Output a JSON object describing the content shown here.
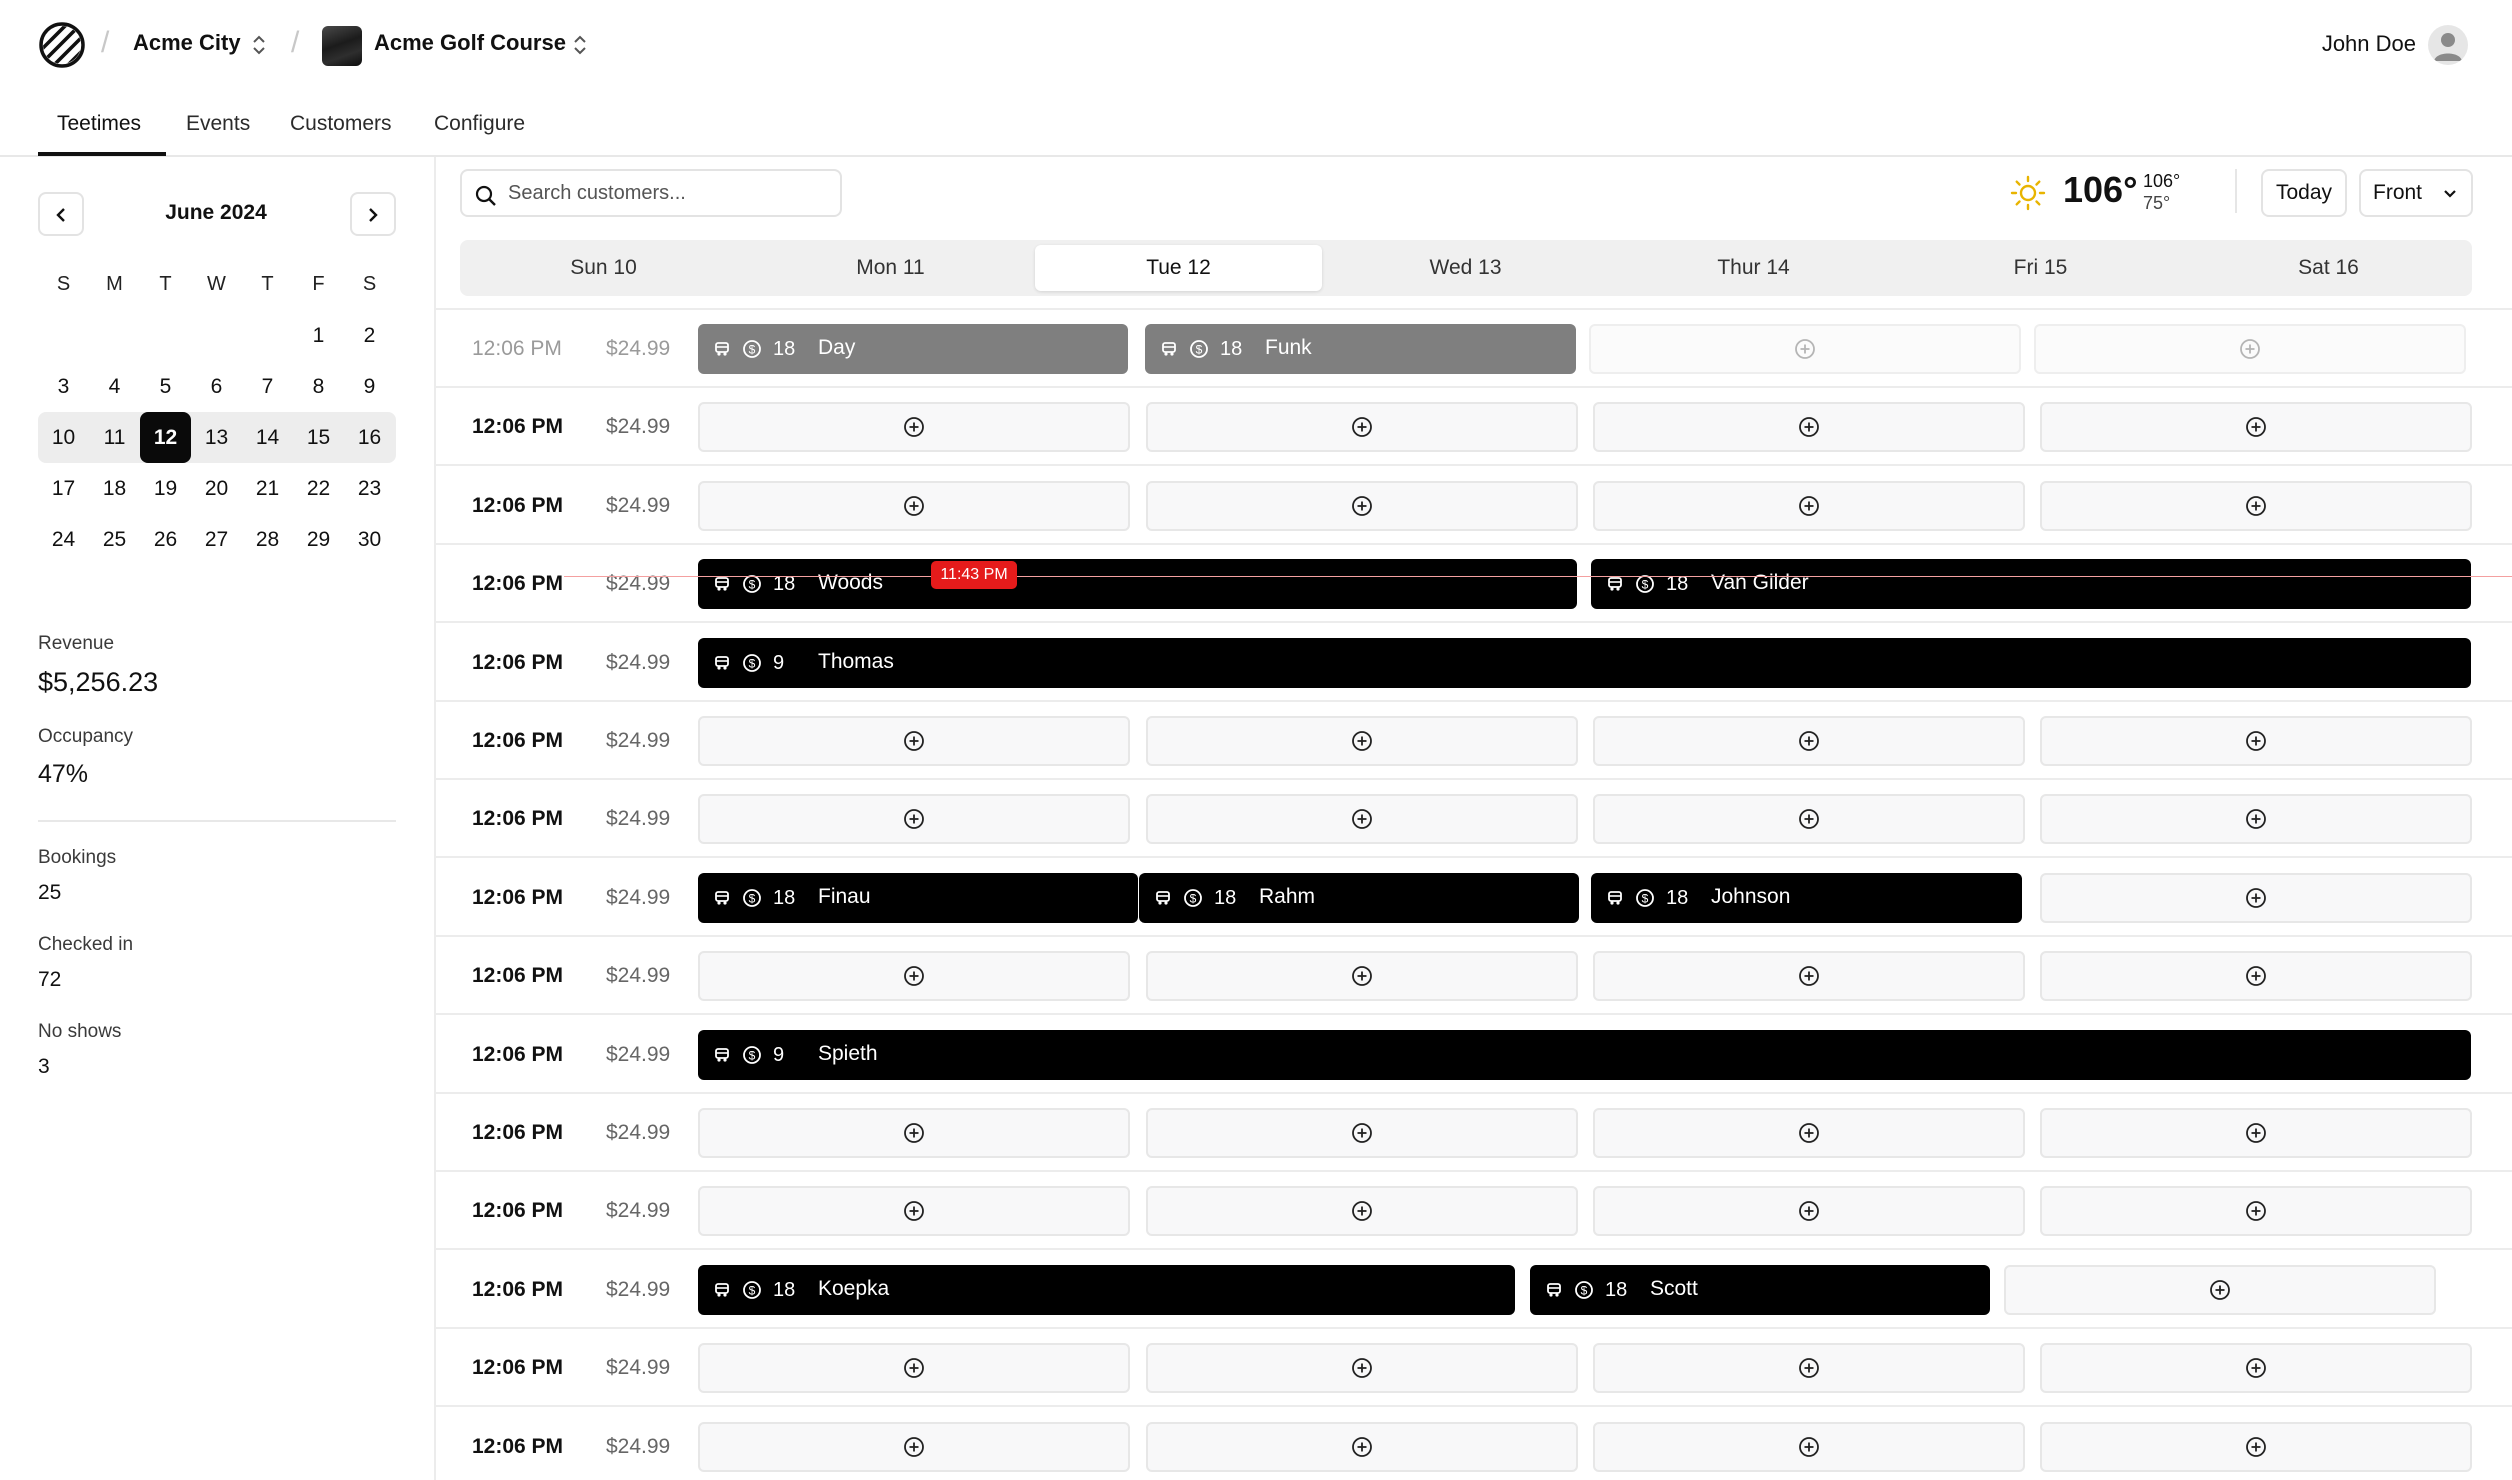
{
  "header": {
    "org": "Acme City",
    "course": "Acme Golf Course",
    "user": "John Doe"
  },
  "tabs": [
    "Teetimes",
    "Events",
    "Customers",
    "Configure"
  ],
  "calendar": {
    "month": "June 2024",
    "weekdays": [
      "S",
      "M",
      "T",
      "W",
      "T",
      "F",
      "S"
    ],
    "selected_day": "12"
  },
  "stats": {
    "revenue_label": "Revenue",
    "revenue_value": "$5,256.23",
    "occupancy_label": "Occupancy",
    "occupancy_value": "47%",
    "bookings_label": "Bookings",
    "bookings_value": "25",
    "checked_in_label": "Checked in",
    "checked_in_value": "72",
    "no_shows_label": "No shows",
    "no_shows_value": "3"
  },
  "toolbar": {
    "search_placeholder": "Search customers...",
    "temp": "106°",
    "temp_high": "106°",
    "temp_low": "75°",
    "today_label": "Today",
    "view_label": "Front"
  },
  "days": [
    "Sun 10",
    "Mon 11",
    "Tue 12",
    "Wed 13",
    "Thur 14",
    "Fri 15",
    "Sat 16"
  ],
  "now_badge": "11:43 PM",
  "rows": [
    {
      "time": "12:06 PM",
      "price": "$24.99"
    },
    {
      "time": "12:06 PM",
      "price": "$24.99"
    },
    {
      "time": "12:06 PM",
      "price": "$24.99"
    },
    {
      "time": "12:06 PM",
      "price": "$24.99"
    },
    {
      "time": "12:06 PM",
      "price": "$24.99"
    },
    {
      "time": "12:06 PM",
      "price": "$24.99"
    },
    {
      "time": "12:06 PM",
      "price": "$24.99"
    },
    {
      "time": "12:06 PM",
      "price": "$24.99"
    },
    {
      "time": "12:06 PM",
      "price": "$24.99"
    },
    {
      "time": "12:06 PM",
      "price": "$24.99"
    },
    {
      "time": "12:06 PM",
      "price": "$24.99"
    },
    {
      "time": "12:06 PM",
      "price": "$24.99"
    },
    {
      "time": "12:06 PM",
      "price": "$24.99"
    },
    {
      "time": "12:06 PM",
      "price": "$24.99"
    },
    {
      "time": "12:06 PM",
      "price": "$24.99"
    }
  ],
  "bookings": {
    "day": {
      "holes": "18",
      "name": "Day"
    },
    "funk": {
      "holes": "18",
      "name": "Funk"
    },
    "woods": {
      "holes": "18",
      "name": "Woods"
    },
    "vangilder": {
      "holes": "18",
      "name": "Van Gilder"
    },
    "thomas": {
      "holes": "9",
      "name": "Thomas"
    },
    "finau": {
      "holes": "18",
      "name": "Finau"
    },
    "rahm": {
      "holes": "18",
      "name": "Rahm"
    },
    "johnson": {
      "holes": "18",
      "name": "Johnson"
    },
    "spieth": {
      "holes": "9",
      "name": "Spieth"
    },
    "koepka": {
      "holes": "18",
      "name": "Koepka"
    },
    "scott": {
      "holes": "18",
      "name": "Scott"
    }
  },
  "colors": {
    "accent": "#000000",
    "past_booking": "#7f7f7f",
    "now_indicator": "#e51b1b",
    "sun": "#e8b400"
  }
}
